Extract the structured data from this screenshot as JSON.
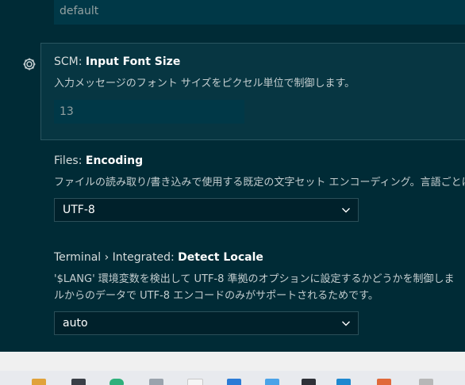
{
  "top_input": {
    "value": "default"
  },
  "scm_font": {
    "category": "SCM: ",
    "name": "Input Font Size",
    "description": "入力メッセージのフォント サイズをピクセル単位で制御します。",
    "value": "13"
  },
  "files_encoding": {
    "category": "Files: ",
    "name": "Encoding",
    "description": "ファイルの読み取り/書き込みで使用する既定の文字セット エンコーディング。言語ごとに",
    "value": "UTF-8"
  },
  "terminal_locale": {
    "category": "Terminal › Integrated: ",
    "name": "Detect Locale",
    "description_line1": "'$LANG' 環境変数を検出して UTF-8 準拠のオプションに設定するかどうかを制御しま",
    "description_line2": "ルからのデータで UTF-8 エンコードのみがサポートされるためです。",
    "value": "auto"
  },
  "taskbar": {
    "icons": [
      "app-icon-1",
      "app-icon-2",
      "app-icon-3",
      "app-icon-4",
      "app-icon-5",
      "app-icon-6",
      "app-icon-7",
      "app-icon-8",
      "vscode-icon",
      "app-icon-9",
      "app-icon-10"
    ]
  }
}
